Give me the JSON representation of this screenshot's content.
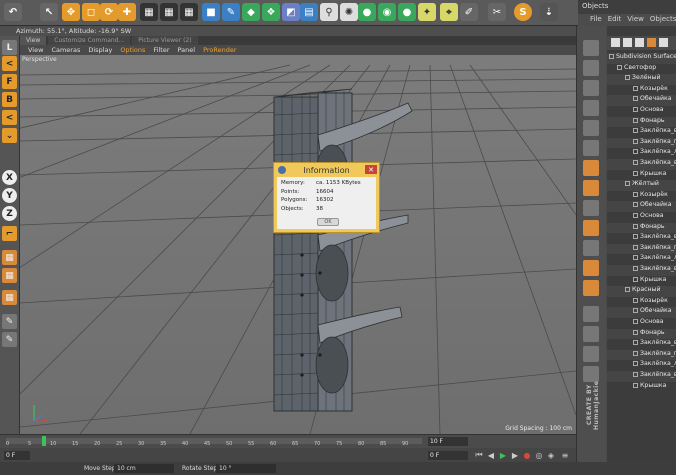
{
  "objects_panel": {
    "title": "Objects",
    "menu": [
      "File",
      "Edit",
      "View",
      "Objects",
      "Ta"
    ]
  },
  "info_line": "Azimuth: 55.1°, Altitude: -16.9°  SW",
  "viewport": {
    "tabs": [
      "View",
      "Customize Command...",
      "Picture Viewer (2)"
    ],
    "menu": [
      "View",
      "Cameras",
      "Display",
      "Options",
      "Filter",
      "Panel",
      "ProRender"
    ],
    "label": "Perspective",
    "grid_spacing": "Grid Spacing : 100 cm"
  },
  "left_tools": [
    "L",
    "<",
    "F",
    "B",
    "<",
    "X",
    "Y",
    "Z"
  ],
  "dialog": {
    "title": "Information",
    "rows": [
      {
        "key": "Memory:",
        "value": "ca. 1153 KBytes"
      },
      {
        "key": "Points:",
        "value": "16604"
      },
      {
        "key": "Polygons:",
        "value": "16302"
      },
      {
        "key": "Objects:",
        "value": "38"
      }
    ],
    "ok": "OK"
  },
  "timeline": {
    "ticks": [
      "0",
      "5",
      "10",
      "15",
      "20",
      "25",
      "30",
      "35",
      "40",
      "45",
      "50",
      "55",
      "60",
      "65",
      "70",
      "75",
      "80",
      "85",
      "90"
    ],
    "current_frame": "0 F",
    "end_frame": "10 F",
    "start_field": "0 F",
    "end_field": "110 F"
  },
  "bottom": {
    "move_step_label": "Move Step",
    "move_step_value": "10 cm",
    "rotate_step_label": "Rotate Step",
    "rotate_step_value": "10 °"
  },
  "watermark": "CREATE BY HumanJackie",
  "tree": [
    {
      "indent": 0,
      "label": "Subdivision Surface"
    },
    {
      "indent": 1,
      "label": "Светофор"
    },
    {
      "indent": 2,
      "label": "Зелёный"
    },
    {
      "indent": 3,
      "label": "Козырёк"
    },
    {
      "indent": 3,
      "label": "Обечайка"
    },
    {
      "indent": 3,
      "label": "Основа"
    },
    {
      "indent": 3,
      "label": "Фонарь"
    },
    {
      "indent": 3,
      "label": "Заклёпка_вер"
    },
    {
      "indent": 3,
      "label": "Заклёпка_пр"
    },
    {
      "indent": 3,
      "label": "Заклёпка_ле"
    },
    {
      "indent": 3,
      "label": "Заклёпка_вн"
    },
    {
      "indent": 3,
      "label": "Крышка"
    },
    {
      "indent": 2,
      "label": "Жёлтый"
    },
    {
      "indent": 3,
      "label": "Козырёк"
    },
    {
      "indent": 3,
      "label": "Обечайка"
    },
    {
      "indent": 3,
      "label": "Основа"
    },
    {
      "indent": 3,
      "label": "Фонарь"
    },
    {
      "indent": 3,
      "label": "Заклёпка_вер"
    },
    {
      "indent": 3,
      "label": "Заклёпка_пр"
    },
    {
      "indent": 3,
      "label": "Заклёпка_ле"
    },
    {
      "indent": 3,
      "label": "Заклёпка_вн"
    },
    {
      "indent": 3,
      "label": "Крышка"
    },
    {
      "indent": 2,
      "label": "Красный"
    },
    {
      "indent": 3,
      "label": "Козырёк"
    },
    {
      "indent": 3,
      "label": "Обечайка"
    },
    {
      "indent": 3,
      "label": "Основа"
    },
    {
      "indent": 3,
      "label": "Фонарь"
    },
    {
      "indent": 3,
      "label": "Заклёпка_вер"
    },
    {
      "indent": 3,
      "label": "Заклёпка_пр"
    },
    {
      "indent": 3,
      "label": "Заклёпка_ле"
    },
    {
      "indent": 3,
      "label": "Заклёпка_вн"
    },
    {
      "indent": 3,
      "label": "Крышка"
    }
  ]
}
